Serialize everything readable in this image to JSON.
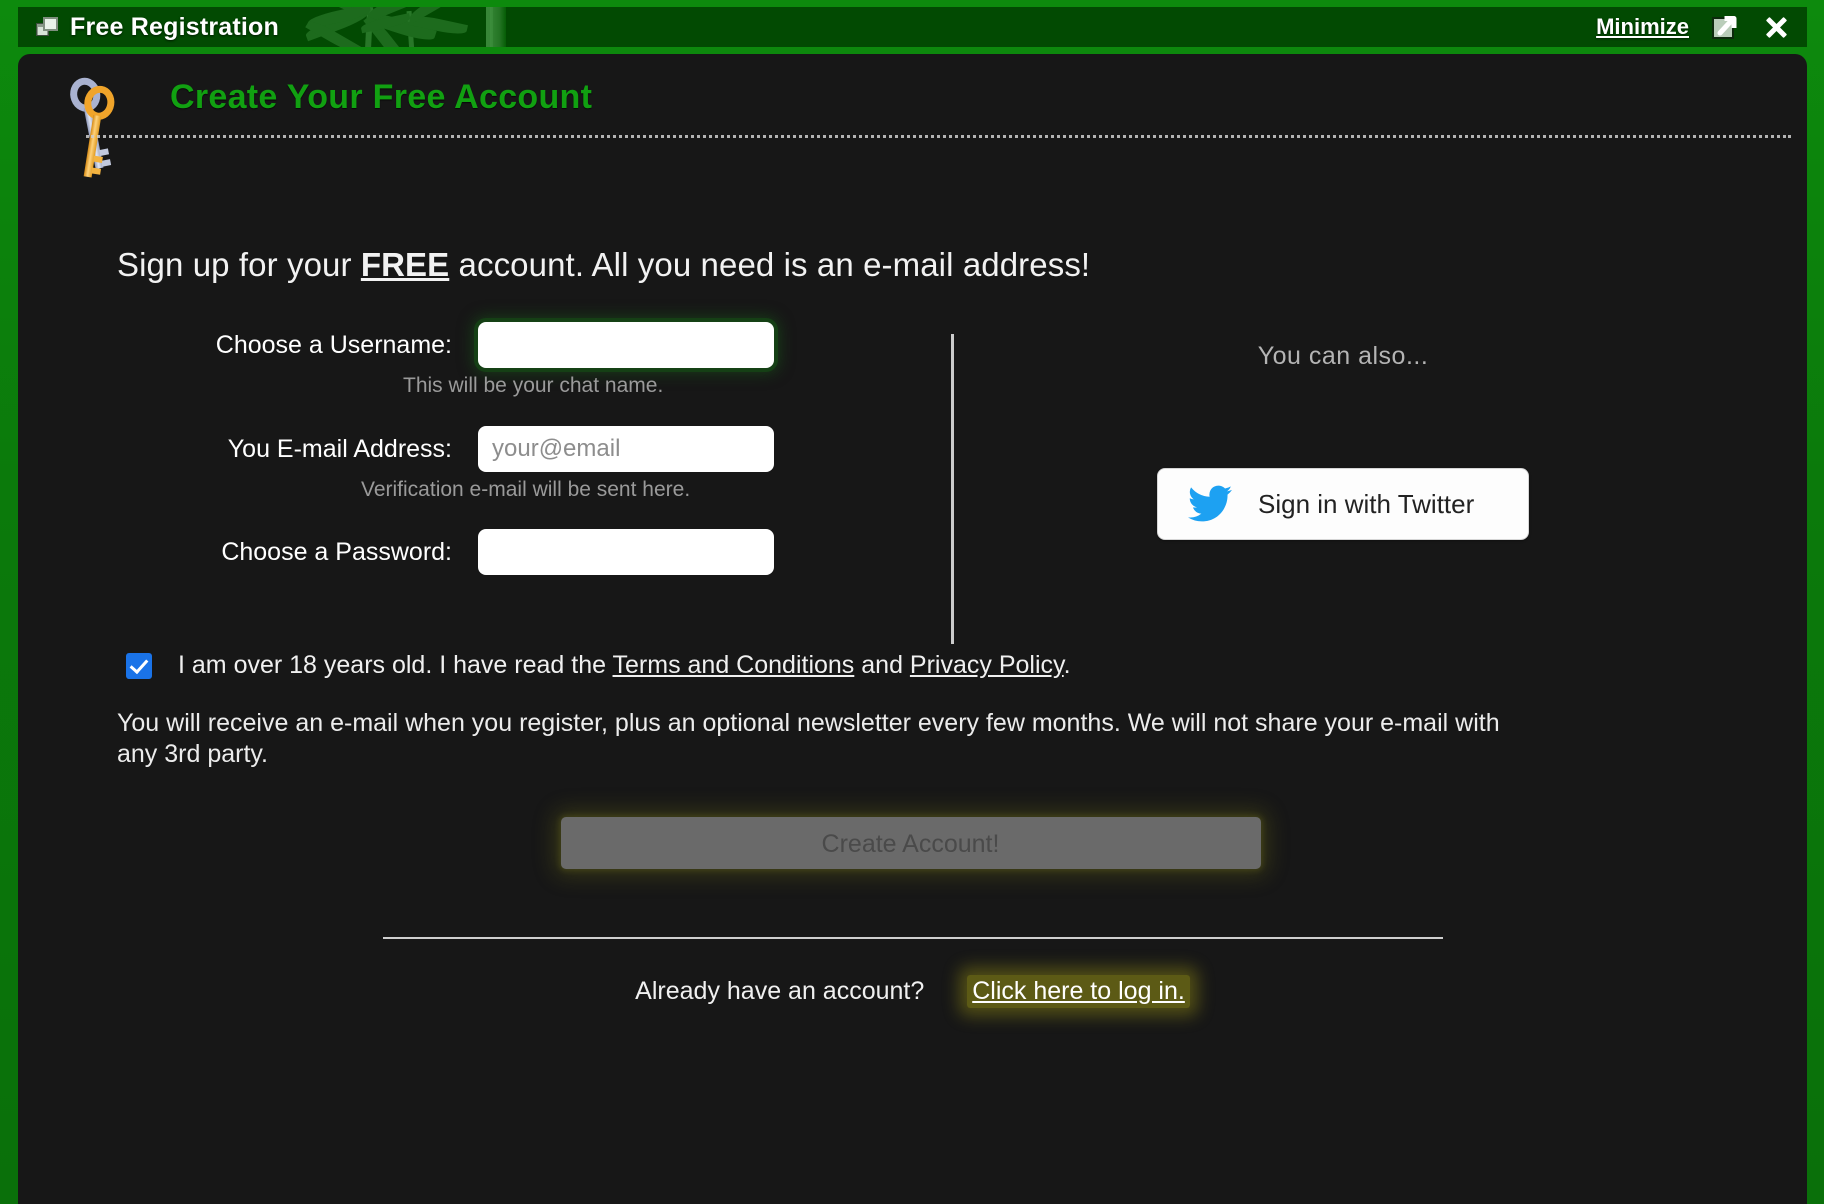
{
  "window": {
    "title": "Free Registration",
    "icon": "cascade-windows-icon",
    "minimize_label": "Minimize",
    "popout_label": "Pop out",
    "close_label": "Close",
    "accent_green": "#0b7a0b",
    "titlebar_green": "#024a03",
    "content_bg": "#171717"
  },
  "panel": {
    "icon": "keys-icon",
    "title": "Create Your Free Account",
    "headline_before": "Sign up for your ",
    "headline_emphasis": "FREE",
    "headline_after": " account.  All you need is an e-mail address!",
    "title_color": "#11a011"
  },
  "form": {
    "username": {
      "label": "Choose a Username:",
      "value": "",
      "placeholder": "",
      "hint": "This will be your chat name."
    },
    "email": {
      "label": "You E-mail Address:",
      "value": "",
      "placeholder": "your@email",
      "hint": "Verification e-mail will be sent here."
    },
    "password": {
      "label": "Choose a Password:",
      "value": "",
      "placeholder": "",
      "hint": ""
    }
  },
  "alternate": {
    "title": "You can also...",
    "twitter_button": {
      "label": "Sign in with Twitter",
      "icon": "twitter-bird-icon",
      "brand_color": "#1da1f2"
    }
  },
  "consent": {
    "checked": true,
    "text_before": "I am over 18 years old. I have read the ",
    "terms_link": "Terms and Conditions",
    "text_middle": " and ",
    "privacy_link": "Privacy Policy",
    "text_after": ".",
    "checkbox_color": "#1a73e8"
  },
  "notice": "You will receive an e-mail when you register, plus an optional newsletter every few months. We will not share your e-mail with any 3rd party.",
  "submit": {
    "label": "Create Account!",
    "enabled": false
  },
  "footer": {
    "prompt": "Already have an account?",
    "link": "Click here to log in.",
    "link_highlight": "#969114"
  }
}
